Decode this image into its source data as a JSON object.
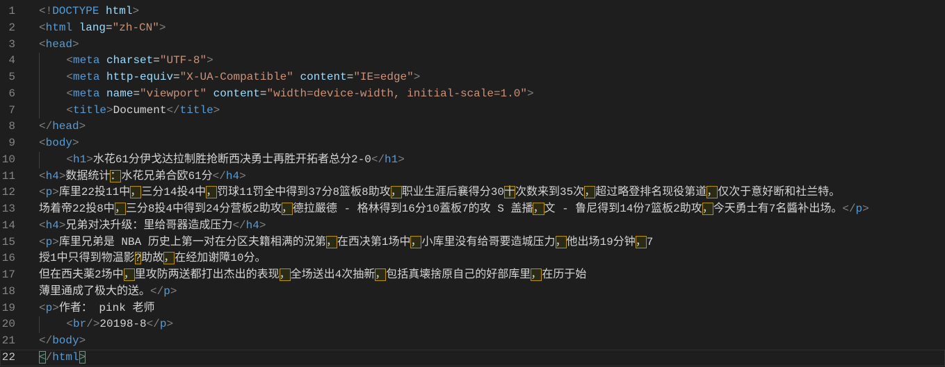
{
  "editor": {
    "current_line": 22,
    "lines": [
      [
        [
          "g",
          "<!"
        ],
        [
          "t",
          "DOCTYPE"
        ],
        [
          "x",
          " "
        ],
        [
          "a",
          "html"
        ],
        [
          "g",
          ">"
        ]
      ],
      [
        [
          "g",
          "<"
        ],
        [
          "t",
          "html"
        ],
        [
          "x",
          " "
        ],
        [
          "a",
          "lang"
        ],
        [
          "x",
          "="
        ],
        [
          "s",
          "\"zh-CN\""
        ],
        [
          "g",
          ">"
        ]
      ],
      [
        [
          "g",
          "<"
        ],
        [
          "t",
          "head"
        ],
        [
          "g",
          ">"
        ]
      ],
      [
        [
          "i",
          "    "
        ],
        [
          "g",
          "<"
        ],
        [
          "t",
          "meta"
        ],
        [
          "x",
          " "
        ],
        [
          "a",
          "charset"
        ],
        [
          "x",
          "="
        ],
        [
          "s",
          "\"UTF-8\""
        ],
        [
          "g",
          ">"
        ]
      ],
      [
        [
          "i",
          "    "
        ],
        [
          "g",
          "<"
        ],
        [
          "t",
          "meta"
        ],
        [
          "x",
          " "
        ],
        [
          "a",
          "http-equiv"
        ],
        [
          "x",
          "="
        ],
        [
          "s",
          "\"X-UA-Compatible\""
        ],
        [
          "x",
          " "
        ],
        [
          "a",
          "content"
        ],
        [
          "x",
          "="
        ],
        [
          "s",
          "\"IE=edge\""
        ],
        [
          "g",
          ">"
        ]
      ],
      [
        [
          "i",
          "    "
        ],
        [
          "g",
          "<"
        ],
        [
          "t",
          "meta"
        ],
        [
          "x",
          " "
        ],
        [
          "a",
          "name"
        ],
        [
          "x",
          "="
        ],
        [
          "s",
          "\"viewport\""
        ],
        [
          "x",
          " "
        ],
        [
          "a",
          "content"
        ],
        [
          "x",
          "="
        ],
        [
          "s",
          "\"width=device-width, initial-scale=1.0\""
        ],
        [
          "g",
          ">"
        ]
      ],
      [
        [
          "i",
          "    "
        ],
        [
          "g",
          "<"
        ],
        [
          "t",
          "title"
        ],
        [
          "g",
          ">"
        ],
        [
          "x",
          "Document"
        ],
        [
          "g",
          "</"
        ],
        [
          "t",
          "title"
        ],
        [
          "g",
          ">"
        ]
      ],
      [
        [
          "g",
          "</"
        ],
        [
          "t",
          "head"
        ],
        [
          "g",
          ">"
        ]
      ],
      [
        [
          "g",
          "<"
        ],
        [
          "t",
          "body"
        ],
        [
          "g",
          ">"
        ]
      ],
      [
        [
          "i",
          "    "
        ],
        [
          "g",
          "<"
        ],
        [
          "t",
          "h1"
        ],
        [
          "g",
          ">"
        ],
        [
          "x",
          "水花61分伊戈达拉制胜抢断西决勇士再胜开拓者总分2-0"
        ],
        [
          "g",
          "</"
        ],
        [
          "t",
          "h1"
        ],
        [
          "g",
          ">"
        ]
      ],
      [
        [
          "g",
          "<"
        ],
        [
          "t",
          "h4"
        ],
        [
          "g",
          ">"
        ],
        [
          "x",
          "数据统计"
        ],
        [
          "h",
          "："
        ],
        [
          "x",
          "水花兄弟合欧61分"
        ],
        [
          "g",
          "</"
        ],
        [
          "t",
          "h4"
        ],
        [
          "g",
          ">"
        ]
      ],
      [
        [
          "g",
          "<"
        ],
        [
          "t",
          "p"
        ],
        [
          "g",
          ">"
        ],
        [
          "x",
          "库里22投11中"
        ],
        [
          "h",
          "，"
        ],
        [
          "x",
          "三分14投4中"
        ],
        [
          "h",
          "，"
        ],
        [
          "x",
          "罚球11罚全中得到37分8篮板8助攻"
        ],
        [
          "h",
          "，"
        ],
        [
          "x",
          "职业生涯后襄得分30"
        ],
        [
          "h",
          "十"
        ],
        [
          "x",
          "次数来到35次"
        ],
        [
          "h",
          "，"
        ],
        [
          "x",
          "超过略登排名现役第道"
        ],
        [
          "h",
          "，"
        ],
        [
          "x",
          "仅次于意好断和社兰特。"
        ]
      ],
      [
        [
          "x",
          "场着帝22投8中"
        ],
        [
          "h",
          "，"
        ],
        [
          "x",
          "三分8投4中得到24分营板2助攻"
        ],
        [
          "h",
          "，"
        ],
        [
          "x",
          "德拉嚴德 - 格林得到16分10蓋板7的攻 S 盖播"
        ],
        [
          "h",
          "，"
        ],
        [
          "x",
          "文 - 鲁尼得到14份7篮板2助攻"
        ],
        [
          "h",
          "，"
        ],
        [
          "x",
          "今天勇士有7名醬补出场。"
        ],
        [
          "g",
          "</"
        ],
        [
          "t",
          "p"
        ],
        [
          "g",
          ">"
        ]
      ],
      [
        [
          "g",
          "<"
        ],
        [
          "t",
          "h4"
        ],
        [
          "g",
          ">"
        ],
        [
          "x",
          "兄弟对决升级：里给哥器造成压力"
        ],
        [
          "g",
          "</"
        ],
        [
          "t",
          "h4"
        ],
        [
          "g",
          ">"
        ]
      ],
      [
        [
          "g",
          "<"
        ],
        [
          "t",
          "p"
        ],
        [
          "g",
          ">"
        ],
        [
          "x",
          "库里兄弟是 NBA 历史上第一对在分区夫籍相满的況第"
        ],
        [
          "h",
          "，"
        ],
        [
          "x",
          "在西决第1场中"
        ],
        [
          "h",
          "，"
        ],
        [
          "x",
          "小库里没有给哥要造城压力"
        ],
        [
          "h",
          "，"
        ],
        [
          "x",
          "他出场19分钟"
        ],
        [
          "h",
          "，"
        ],
        [
          "x",
          "7"
        ]
      ],
      [
        [
          "x",
          "授1中只得到物温影"
        ],
        [
          "h",
          "?"
        ],
        [
          "x",
          "助故"
        ],
        [
          "h",
          "，"
        ],
        [
          "x",
          "在经加谢障10分。"
        ]
      ],
      [
        [
          "x",
          "但在西夫薬2场中"
        ],
        [
          "h",
          "，"
        ],
        [
          "x",
          "里攻防两送都打出杰出的表现"
        ],
        [
          "h",
          "，"
        ],
        [
          "x",
          "全场送出4次抽新"
        ],
        [
          "h",
          "，"
        ],
        [
          "x",
          "包括真壊捨原自己的好部库里"
        ],
        [
          "h",
          "，"
        ],
        [
          "x",
          "在历于始"
        ]
      ],
      [
        [
          "x",
          "薄里通成了极大的送。"
        ],
        [
          "g",
          "</"
        ],
        [
          "t",
          "p"
        ],
        [
          "g",
          ">"
        ]
      ],
      [
        [
          "g",
          "<"
        ],
        [
          "t",
          "p"
        ],
        [
          "g",
          ">"
        ],
        [
          "x",
          "作者： pink 老师"
        ]
      ],
      [
        [
          "i",
          "    "
        ],
        [
          "g",
          "<"
        ],
        [
          "t",
          "br"
        ],
        [
          "g",
          "/>"
        ],
        [
          "x",
          "20198-8"
        ],
        [
          "g",
          "</"
        ],
        [
          "t",
          "p"
        ],
        [
          "g",
          ">"
        ]
      ],
      [
        [
          "g",
          "</"
        ],
        [
          "t",
          "body"
        ],
        [
          "g",
          ">"
        ]
      ],
      [
        [
          "m",
          "<"
        ],
        [
          "g",
          "/"
        ],
        [
          "t",
          "html"
        ],
        [
          "m",
          ">"
        ]
      ]
    ]
  }
}
